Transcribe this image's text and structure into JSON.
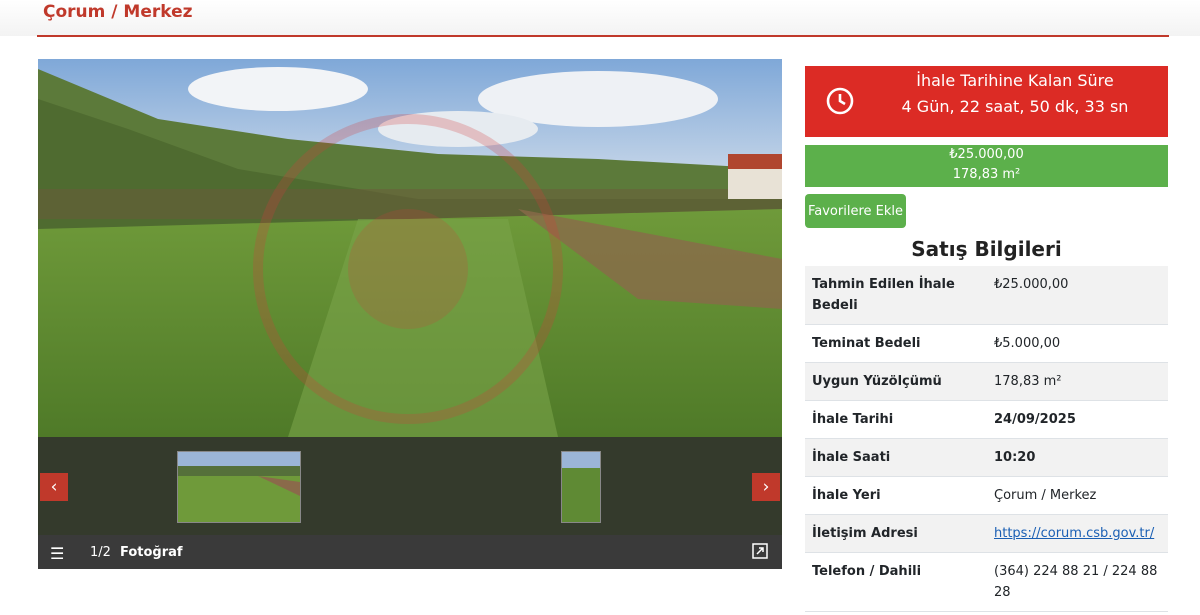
{
  "header": {
    "title": "Çorum / Merkez"
  },
  "gallery": {
    "counter": "1/2",
    "label": "Fotoğraf",
    "prev_icon": "chevron-left-icon",
    "next_icon": "chevron-right-icon"
  },
  "countdown": {
    "title": "İhale Tarihine Kalan Süre",
    "time": "4 Gün, 22 saat, 50 dk, 33 sn",
    "icon": "clock-icon",
    "color": "#dc2b25"
  },
  "price": {
    "amount": "₺25.000,00",
    "area": "178,83 m²",
    "color": "#5cb04b"
  },
  "favorite_button": {
    "label": "Favorilere Ekle"
  },
  "sales_info": {
    "title": "Satış Bilgileri",
    "rows": [
      {
        "key": "Tahmin Edilen İhale Bedeli",
        "value": "₺25.000,00"
      },
      {
        "key": "Teminat Bedeli",
        "value": "₺5.000,00"
      },
      {
        "key": "Uygun Yüzölçümü",
        "value": "178,83 m²"
      },
      {
        "key": "İhale Tarihi",
        "value": "24/09/2025"
      },
      {
        "key": "İhale Saati",
        "value": "10:20"
      },
      {
        "key": "İhale Yeri",
        "value": "Çorum / Merkez"
      },
      {
        "key": "İletişim Adresi",
        "value": "https://corum.csb.gov.tr/"
      },
      {
        "key": "Telefon / Dahili",
        "value": "(364) 224 88 21 / 224 88 28"
      }
    ]
  }
}
